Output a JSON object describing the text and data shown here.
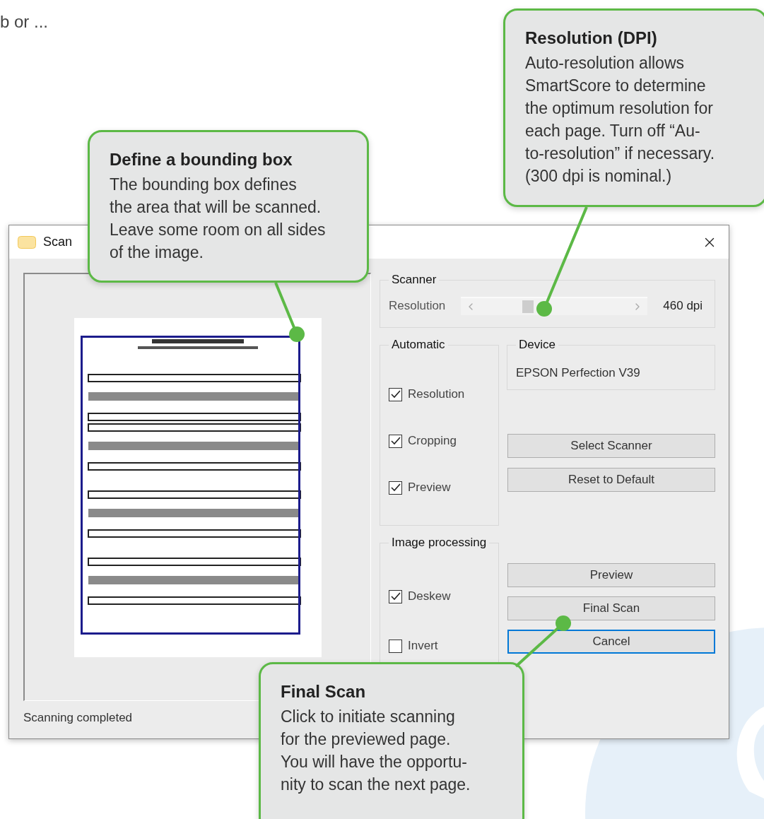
{
  "intro_text": "b or ...",
  "window": {
    "title": "Scan"
  },
  "status_bar": {
    "text": "Scanning completed"
  },
  "scanner_group": {
    "label": "Scanner",
    "resolution_label": "Resolution",
    "resolution_value": "460 dpi",
    "level": 0.36
  },
  "automatic_group": {
    "label": "Automatic",
    "options": [
      {
        "label": "Resolution",
        "checked": true
      },
      {
        "label": "Cropping",
        "checked": true
      },
      {
        "label": "Preview",
        "checked": true
      }
    ]
  },
  "device_group": {
    "label": "Device",
    "device": "EPSON Perfection V39"
  },
  "device_buttons": [
    {
      "label": "Select Scanner",
      "focused": false
    },
    {
      "label": "Reset to Default",
      "focused": false
    }
  ],
  "image_processing_group": {
    "label": "Image processing",
    "options": [
      {
        "label": "Deskew",
        "checked": true
      },
      {
        "label": "Invert",
        "checked": false
      }
    ]
  },
  "scan_buttons": [
    {
      "label": "Preview",
      "focused": false
    },
    {
      "label": "Final Scan",
      "focused": false
    },
    {
      "label": "Cancel",
      "focused": true
    }
  ],
  "callouts": [
    {
      "title": "Define a bounding box",
      "text": "The bounding box defines\nthe area that will be scanned.\nLeave some room on all sides\nof the image."
    },
    {
      "title": "Resolution (DPI)",
      "text": "Auto-resolution allows\nSmartScore to determine\nthe optimum resolution for\neach page. Turn off “Au-\nto-resolution” if necessary.\n(300 dpi is nominal.)"
    },
    {
      "title": "Final Scan",
      "text": "Click to initiate scanning\nfor the previewed page.\nYou will have the opportu-\nnity to scan the next page."
    }
  ]
}
